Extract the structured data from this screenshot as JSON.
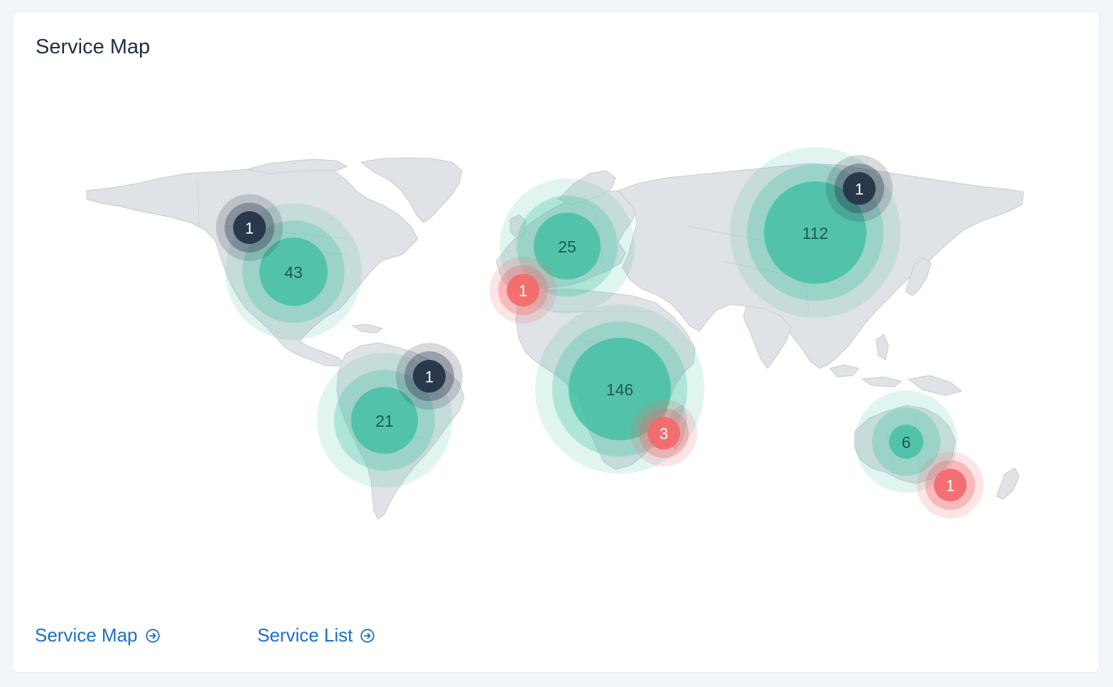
{
  "card": {
    "title": "Service Map"
  },
  "map": {
    "colors": {
      "land": "#dfe2e6",
      "healthy": "#3dbf9f",
      "healthy_text": "#1f5a4c",
      "dark": "#253447",
      "dark_text": "#ffffff",
      "alert": "#f26b6e",
      "alert_text": "#ffffff"
    },
    "clusters": [
      {
        "id": "north-america",
        "count": "43",
        "status": "healthy"
      },
      {
        "id": "north-america-west",
        "count": "1",
        "status": "dark"
      },
      {
        "id": "south-america",
        "count": "21",
        "status": "healthy"
      },
      {
        "id": "south-america-east",
        "count": "1",
        "status": "dark"
      },
      {
        "id": "europe",
        "count": "25",
        "status": "healthy"
      },
      {
        "id": "iberia",
        "count": "1",
        "status": "alert"
      },
      {
        "id": "africa",
        "count": "146",
        "status": "healthy"
      },
      {
        "id": "madagascar",
        "count": "3",
        "status": "alert"
      },
      {
        "id": "asia",
        "count": "112",
        "status": "healthy"
      },
      {
        "id": "siberia",
        "count": "1",
        "status": "dark"
      },
      {
        "id": "australia",
        "count": "6",
        "status": "healthy"
      },
      {
        "id": "australia-southeast",
        "count": "1",
        "status": "alert"
      }
    ]
  },
  "footer": {
    "service_map_label": "Service Map",
    "service_list_label": "Service List",
    "link_icon": "arrow-circle-right-icon"
  }
}
